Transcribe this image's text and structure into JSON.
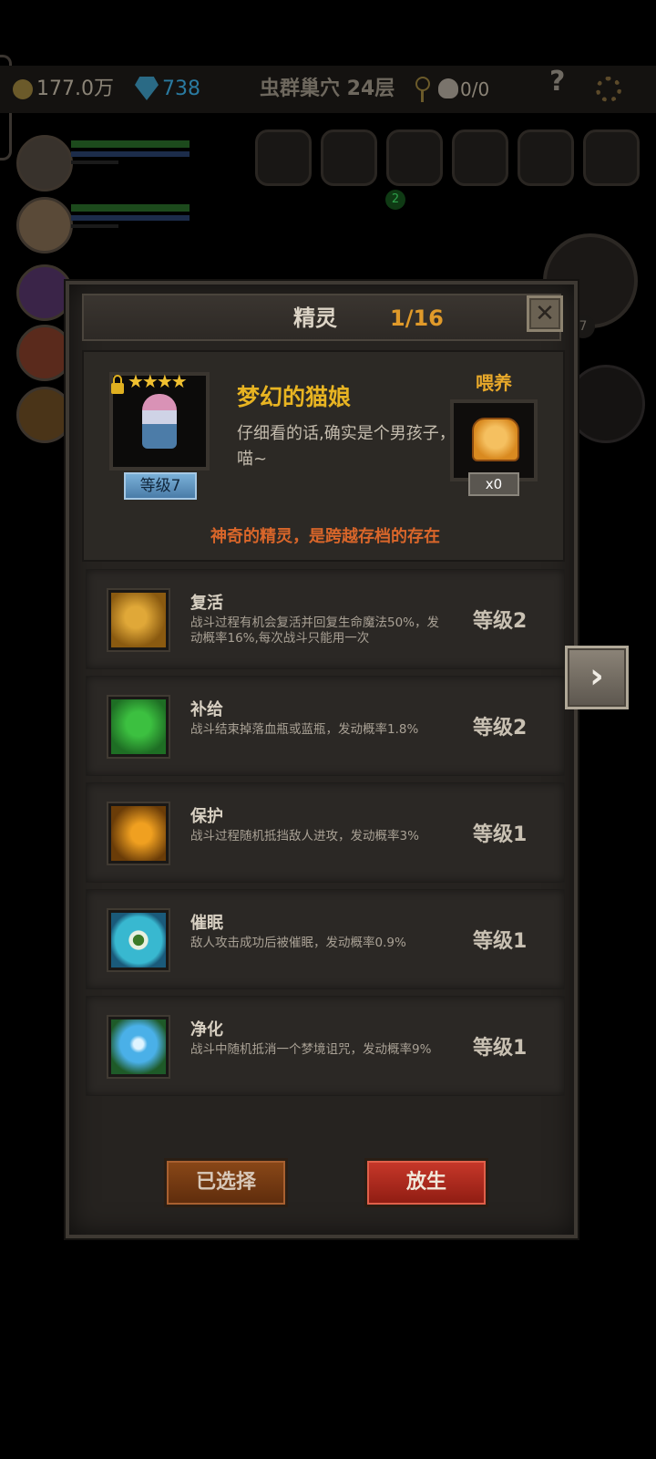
{
  "status_bar": {
    "gold": "177.0万",
    "gems": "738",
    "location": "虫群巢穴 24层",
    "skulls": "0/0",
    "help": "?"
  },
  "equipment_badge": "2",
  "side_badge": "7",
  "dialog": {
    "title": "精灵",
    "count": "1/16",
    "close": "✕",
    "pet": {
      "stars": "★★★★",
      "level": "等级7",
      "name": "梦幻的猫娘",
      "description": "仔细看的话,确实是个男孩子，喵~",
      "feed_label": "喂养",
      "feed_count": "x0",
      "tagline": "神奇的精灵，是跨越存档的存在"
    },
    "skills": [
      {
        "name": "复活",
        "desc": "战斗过程有机会复活并回复生命魔法50%，发动概率16%,每次战斗只能用一次",
        "level": "等级2",
        "icon": "revive-icon"
      },
      {
        "name": "补给",
        "desc": "战斗结束掉落血瓶或蓝瓶，发动概率1.8%",
        "level": "等级2",
        "icon": "supply-icon"
      },
      {
        "name": "保护",
        "desc": "战斗过程随机抵挡敌人进攻，发动概率3%",
        "level": "等级1",
        "icon": "protect-icon"
      },
      {
        "name": "催眠",
        "desc": "敌人攻击成功后被催眠，发动概率0.9%",
        "level": "等级1",
        "icon": "hypnosis-icon"
      },
      {
        "name": "净化",
        "desc": "战斗中随机抵消一个梦境诅咒，发动概率9%",
        "level": "等级1",
        "icon": "purify-icon"
      }
    ],
    "buttons": {
      "selected": "已选择",
      "release": "放生"
    },
    "next": "›"
  }
}
